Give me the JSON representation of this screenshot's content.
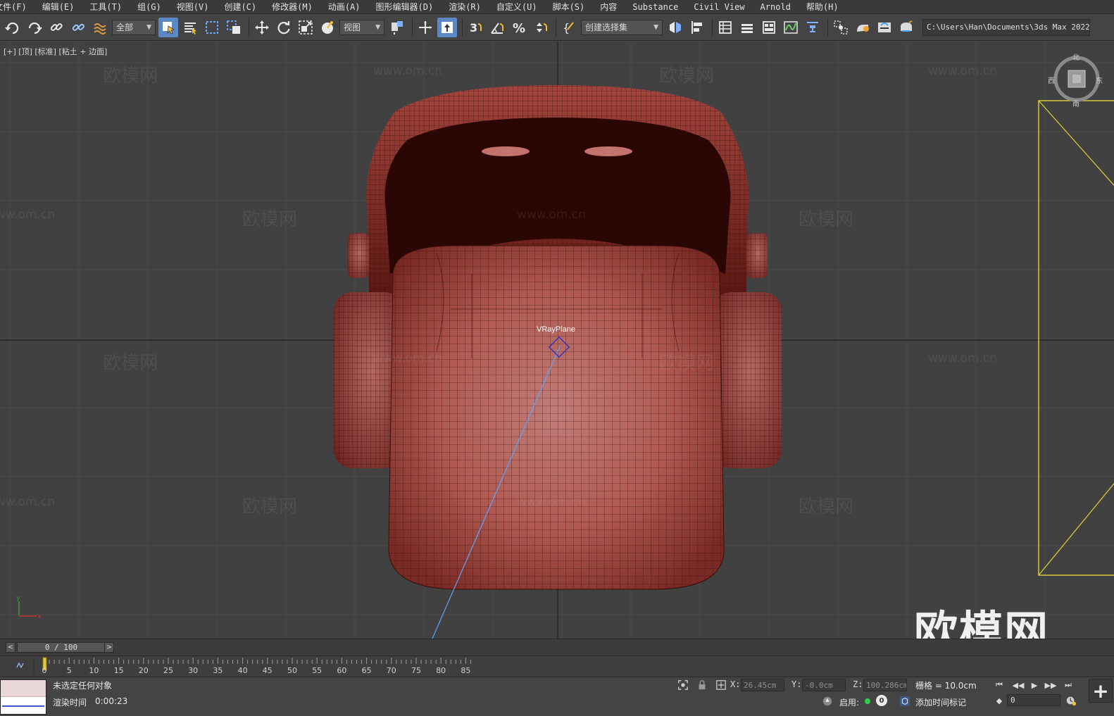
{
  "menu": {
    "items": [
      "文件(F)",
      "编辑(E)",
      "工具(T)",
      "组(G)",
      "视图(V)",
      "创建(C)",
      "修改器(M)",
      "动画(A)",
      "图形编辑器(D)",
      "渲染(R)",
      "自定义(U)",
      "脚本(S)",
      "内容",
      "Substance",
      "Civil View",
      "Arnold",
      "帮助(H)"
    ]
  },
  "toolbar": {
    "selection_filter": "全部",
    "reference_coord": "视图",
    "named_selection_set": "创建选择集",
    "project_path": "C:\\Users\\Han\\Documents\\3ds Max 2022"
  },
  "viewport": {
    "label": "[+] [顶] [标准] [粘土 + 边面]",
    "object_label": "VRayPlane",
    "compass": {
      "north": "北",
      "south": "南",
      "east": "东",
      "west": "西"
    },
    "watermark_text": "欧模网",
    "watermark_url": "www.om.cn",
    "watermark_big": "欧模网"
  },
  "timeslider": {
    "position": "0 / 100",
    "prev": "<",
    "next": ">"
  },
  "trackbar": {
    "ticks": [
      "0",
      "5",
      "10",
      "15",
      "20",
      "25",
      "30",
      "35",
      "40",
      "45",
      "50",
      "55",
      "60",
      "65",
      "70",
      "75",
      "80",
      "85"
    ]
  },
  "status": {
    "selection_text": "未选定任何对象",
    "render_time_label": "渲染时间",
    "render_time_value": "0:00:23",
    "x_label": "X:",
    "x_value": "26.45cm",
    "y_label": "Y:",
    "y_value": "-0.0cm",
    "z_label": "Z:",
    "z_value": "100.286cm",
    "grid_label": "栅格 = 10.0cm",
    "enabled_label": "启用:",
    "enabled_count": "0",
    "add_time_tag": "添加时间标记",
    "frame_value": "0",
    "plus_label": "+"
  },
  "colors": {
    "model_base": "#b15a52",
    "model_dark": "#2a0605",
    "selection_box": "#e3d236",
    "active_button": "#5b87c4",
    "light_line": "#5aa6ff"
  }
}
